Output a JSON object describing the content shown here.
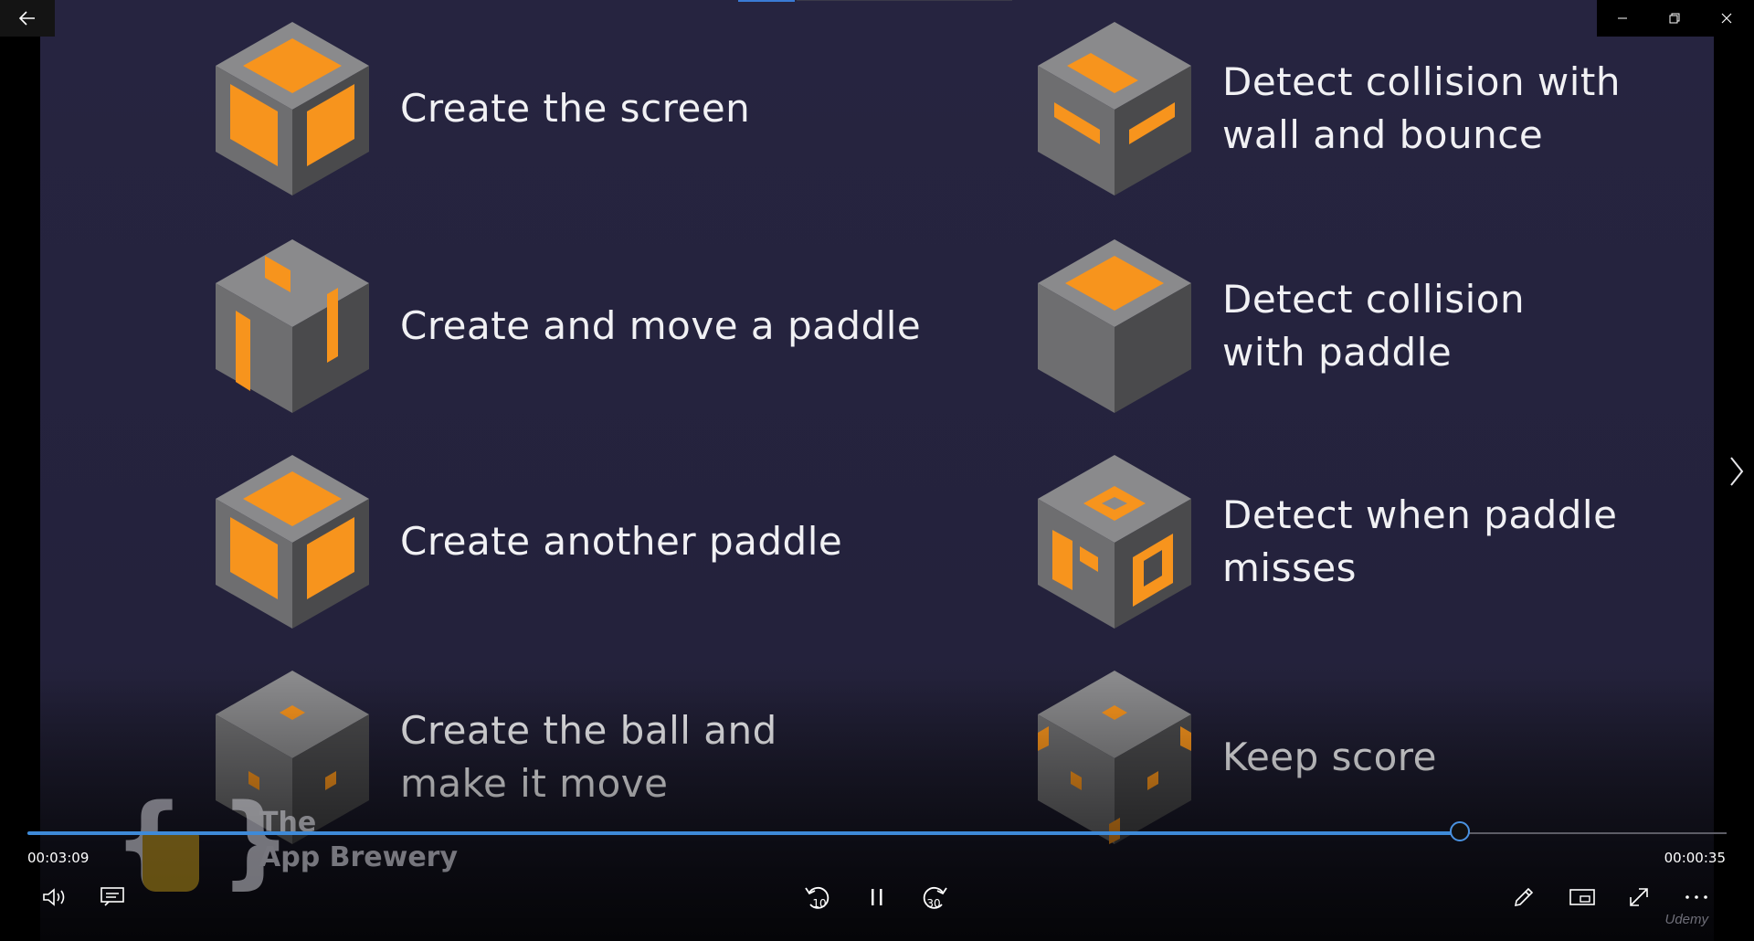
{
  "slide": {
    "items": [
      {
        "label": "Create the screen"
      },
      {
        "label": "Create and move a paddle"
      },
      {
        "label": "Create another paddle"
      },
      {
        "label": "Create the ball and\nmake it move"
      },
      {
        "label": "Detect collision with\nwall and bounce"
      },
      {
        "label": "Detect collision\nwith paddle"
      },
      {
        "label": "Detect when paddle\nmisses"
      },
      {
        "label": "Keep score"
      }
    ],
    "watermark": {
      "text": "The\nApp Brewery"
    },
    "colors": {
      "accent": "#f7941d",
      "cube_gray": "#6e6e70",
      "background": "#262440"
    }
  },
  "player": {
    "elapsed": "00:03:09",
    "remaining": "00:00:35",
    "progress": 0.843,
    "brand": "Udemy",
    "icons": {
      "back": "back-arrow-icon",
      "minimize": "minimize-icon",
      "restore": "restore-icon",
      "close": "close-icon",
      "next": "chevron-right-icon",
      "volume": "volume-icon",
      "captions": "captions-icon",
      "skip_back": "skip-back-10-icon",
      "pause": "pause-icon",
      "skip_forward": "skip-forward-30-icon",
      "pen": "pen-icon",
      "miniplayer": "miniplayer-icon",
      "fullscreen": "fullscreen-icon",
      "more": "more-icon"
    },
    "skip_back_seconds": "10",
    "skip_forward_seconds": "30"
  }
}
